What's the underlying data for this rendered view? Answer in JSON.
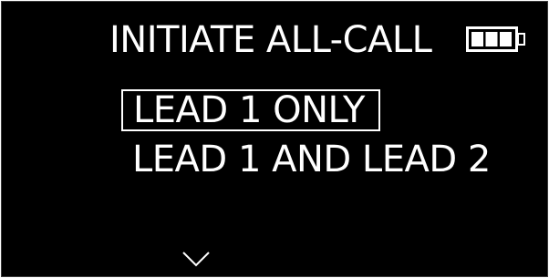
{
  "screen": {
    "title": "INITIATE ALL-CALL",
    "battery_icon": "battery-full-icon",
    "battery_level": 1.0,
    "colors": {
      "background": "#000000",
      "foreground": "#ffffff"
    }
  },
  "menu": {
    "items": [
      {
        "label": "LEAD 1 ONLY",
        "selected": true
      },
      {
        "label": "LEAD 1 AND LEAD 2",
        "selected": false
      }
    ],
    "more_indicator_icon": "chevron-down-icon"
  }
}
